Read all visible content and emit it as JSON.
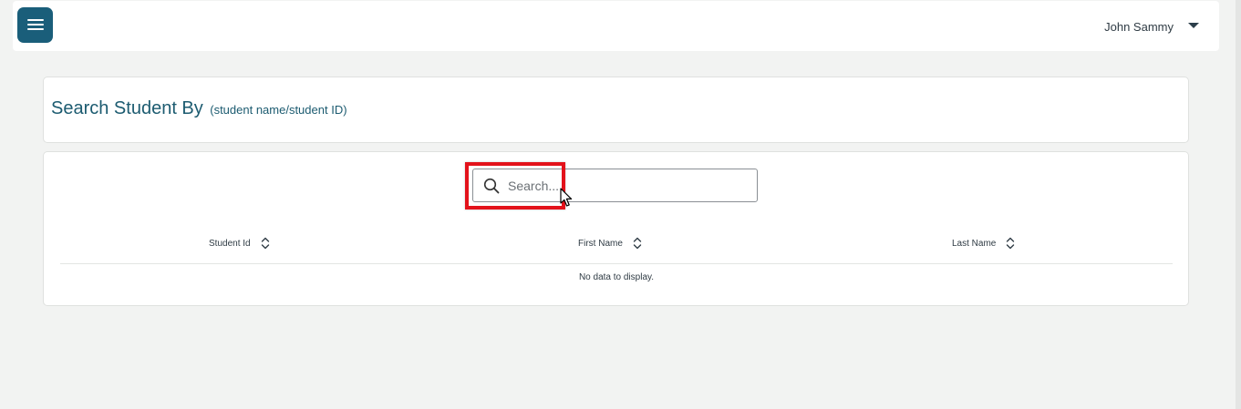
{
  "header": {
    "menu_icon": "hamburger-menu-icon",
    "user_name": "John Sammy",
    "user_menu_icon": "caret-down-icon"
  },
  "page": {
    "title": "Search Student By",
    "subtitle": "(student name/student ID)"
  },
  "search": {
    "placeholder": "Search...",
    "value": "",
    "icon": "search-icon"
  },
  "table": {
    "columns": [
      {
        "label": "Student Id",
        "sort_icon": "sort-icon"
      },
      {
        "label": "First Name",
        "sort_icon": "sort-icon"
      },
      {
        "label": "Last Name",
        "sort_icon": "sort-icon"
      }
    ],
    "rows": [],
    "empty_message": "No data to display."
  },
  "colors": {
    "brand": "#1a5e7a",
    "title_text": "#1c5b70",
    "highlight": "#e3121b",
    "page_bg": "#f2f3f2"
  }
}
